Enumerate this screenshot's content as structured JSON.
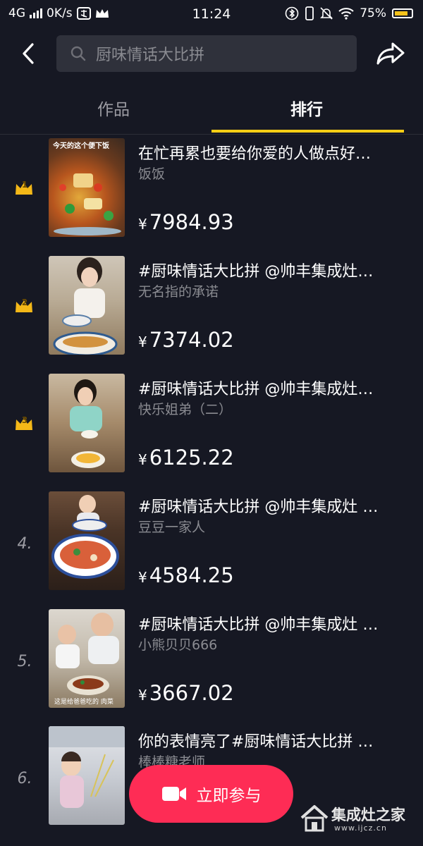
{
  "status_bar": {
    "network": "4G",
    "speed": "0K/s",
    "time": "11:24",
    "battery": "75%"
  },
  "search": {
    "query": "厨味情话大比拼"
  },
  "tabs": [
    {
      "label": "作品",
      "active": false
    },
    {
      "label": "排行",
      "active": true
    }
  ],
  "rankings": [
    {
      "rank": "1",
      "title": "在忙再累也要给你爱的人做点好…",
      "author": "饭饭",
      "amount": "7984.93",
      "thumb_caption": "今天的这个便下饭"
    },
    {
      "rank": "2",
      "title": "#厨味情话大比拼  @帅丰集成灶…",
      "author": "无名指的承诺",
      "amount": "7374.02"
    },
    {
      "rank": "3",
      "title": "#厨味情话大比拼  @帅丰集成灶…",
      "author": "快乐姐弟（二）",
      "amount": "6125.22"
    },
    {
      "rank": "4.",
      "title": "#厨味情话大比拼 @帅丰集成灶 …",
      "author": "豆豆一家人",
      "amount": "4584.25"
    },
    {
      "rank": "5.",
      "title": "#厨味情话大比拼 @帅丰集成灶 …",
      "author": "小熊贝贝666",
      "amount": "3667.02",
      "thumb_caption": "这是给爸爸吃的  肉菜"
    },
    {
      "rank": "6.",
      "title": "你的表情亮了#厨味情话大比拼  …",
      "author": "棒棒糖老师",
      "amount": ""
    }
  ],
  "currency_symbol": "¥",
  "cta": {
    "label": "立即参与"
  },
  "watermark": {
    "title": "集成灶之家",
    "url": "www.ijcz.cn"
  },
  "colors": {
    "background": "#161823",
    "accent_yellow": "#face15",
    "cta_red": "#fe2c55",
    "crown_gold": "#f4b818"
  }
}
